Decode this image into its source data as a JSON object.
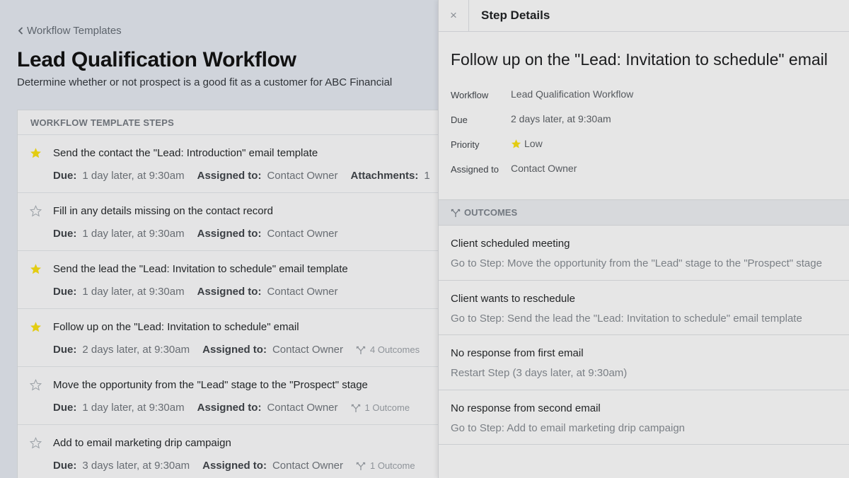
{
  "breadcrumb": {
    "label": "Workflow Templates"
  },
  "page": {
    "title": "Lead Qualification Workflow",
    "subtitle": "Determine whether or not prospect is a good fit as a customer for ABC Financial"
  },
  "steps_panel": {
    "header": "WORKFLOW TEMPLATE STEPS",
    "due_label": "Due:",
    "assigned_label": "Assigned to:",
    "steps": [
      {
        "title": "Send the contact the \"Lead: Introduction\" email template",
        "starred": true,
        "due": "1 day later, at 9:30am",
        "assigned": "Contact Owner",
        "extra_label": "Attachments:",
        "extra_value": "1",
        "outcomes": ""
      },
      {
        "title": "Fill in any details missing on the contact record",
        "starred": false,
        "due": "1 day later, at 9:30am",
        "assigned": "Contact Owner",
        "outcomes": ""
      },
      {
        "title": "Send the lead the \"Lead: Invitation to schedule\" email template",
        "starred": true,
        "due": "1 day later, at 9:30am",
        "assigned": "Contact Owner",
        "outcomes": ""
      },
      {
        "title": "Follow up on the \"Lead: Invitation to schedule\" email",
        "starred": true,
        "due": "2 days later, at 9:30am",
        "assigned": "Contact Owner",
        "outcomes": "4 Outcomes"
      },
      {
        "title": "Move the opportunity from the \"Lead\" stage to the \"Prospect\" stage",
        "starred": false,
        "due": "1 day later, at 9:30am",
        "assigned": "Contact Owner",
        "outcomes": "1 Outcome"
      },
      {
        "title": "Add to email marketing drip campaign",
        "starred": false,
        "due": "3 days later, at 9:30am",
        "assigned": "Contact Owner",
        "outcomes": "1 Outcome"
      }
    ]
  },
  "drawer": {
    "close_glyph": "×",
    "title": "Step Details",
    "step_title": "Follow up on the \"Lead: Invitation to schedule\" email",
    "fields": {
      "workflow_label": "Workflow",
      "workflow_value": "Lead Qualification Workflow",
      "due_label": "Due",
      "due_value": "2 days later, at 9:30am",
      "priority_label": "Priority",
      "priority_value": "Low",
      "assigned_label": "Assigned to",
      "assigned_value": "Contact Owner"
    },
    "outcomes_header": "OUTCOMES",
    "outcomes": [
      {
        "name": "Client scheduled meeting",
        "action": "Go to Step: Move the opportunity from the \"Lead\" stage to the \"Prospect\" stage"
      },
      {
        "name": "Client wants to reschedule",
        "action": "Go to Step: Send the lead the \"Lead: Invitation to schedule\" email template"
      },
      {
        "name": "No response from first email",
        "action": "Restart Step (3 days later, at 9:30am)"
      },
      {
        "name": "No response from second email",
        "action": "Go to Step: Add to email marketing drip campaign"
      }
    ]
  },
  "colors": {
    "star_filled": "#e3cc12",
    "star_empty": "#9aa0a6",
    "background": "#d0d4db",
    "panel": "#e4e4e5"
  },
  "icons": {
    "back": "chevron-left-icon",
    "star": "star-icon",
    "outcomes": "branch-icon",
    "close": "close-icon"
  }
}
